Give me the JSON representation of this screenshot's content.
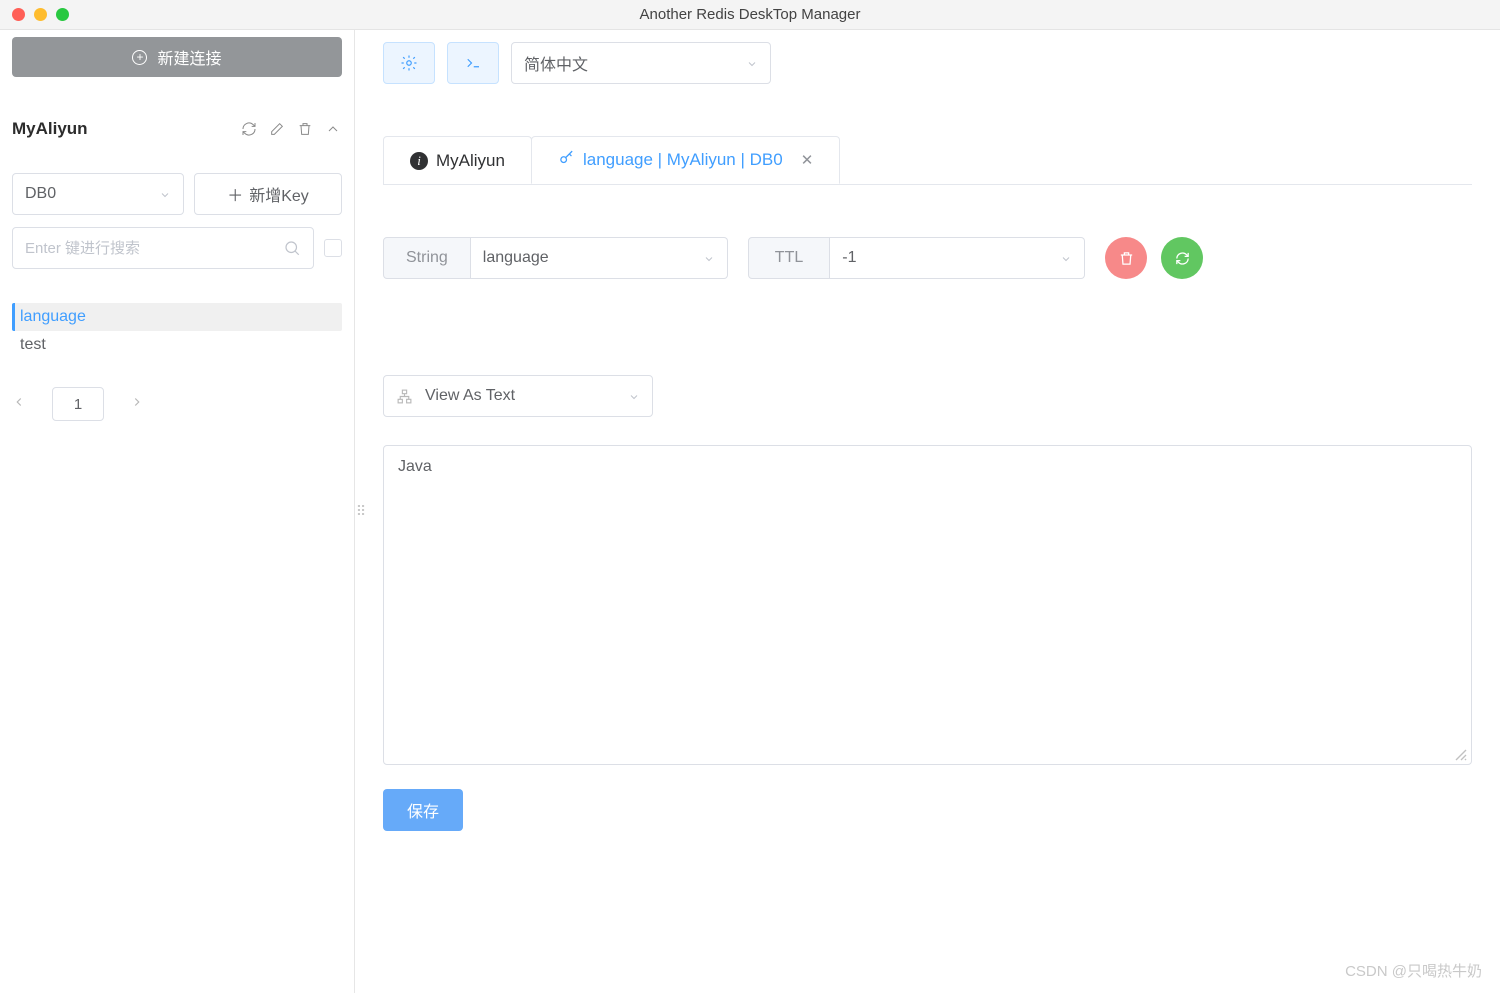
{
  "window": {
    "title": "Another Redis DeskTop Manager"
  },
  "sidebar": {
    "new_connection_label": "新建连接",
    "connection_name": "MyAliyun",
    "db_selected": "DB0",
    "add_key_label": "新增Key",
    "search_placeholder": "Enter 键进行搜索",
    "keys": [
      {
        "name": "language",
        "active": true
      },
      {
        "name": "test",
        "active": false
      }
    ],
    "page_number": "1"
  },
  "toolbar": {
    "language_selected": "简体中文"
  },
  "tabs": {
    "info_label": "MyAliyun",
    "key_label": "language | MyAliyun | DB0"
  },
  "detail": {
    "type_label": "String",
    "key_name": "language",
    "ttl_label": "TTL",
    "ttl_value": "-1",
    "view_as_label": "View As Text",
    "value": "Java",
    "save_label": "保存"
  },
  "watermark": "CSDN @只喝热牛奶"
}
